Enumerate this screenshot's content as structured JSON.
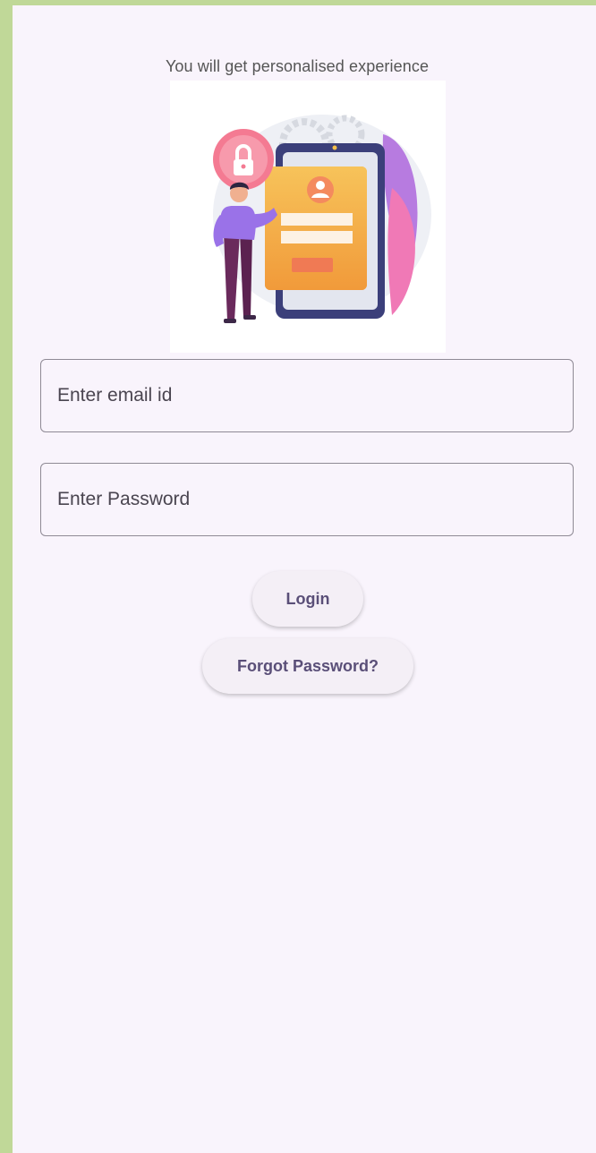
{
  "header": {
    "subtitle": "You will get personalised experience"
  },
  "illustration": {
    "icon": "login-security-illustration"
  },
  "form": {
    "email_placeholder": "Enter email id",
    "email_value": "",
    "password_placeholder": "Enter Password",
    "password_value": ""
  },
  "actions": {
    "login_label": "Login",
    "forgot_label": "Forgot Password?"
  },
  "colors": {
    "page_bg": "#f9f4fc",
    "outer_bg": "#c0d898",
    "button_text": "#5a4f78",
    "field_border": "#8f8a95"
  }
}
